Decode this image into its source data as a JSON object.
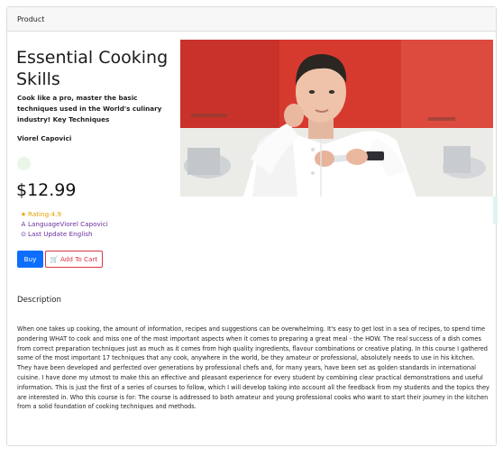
{
  "header": {
    "title": "Product"
  },
  "course": {
    "title": "Essential Cooking Skills",
    "subtitle": "Cook like a pro, master the basic techniques used in the World's culinary industry! Key Techniques",
    "author": "Viorel Capovici",
    "price": "$12.99",
    "rating_text": "Rating:4.9",
    "language_text": "LanguageViorel Capovici",
    "update_text": "Last Update English"
  },
  "actions": {
    "buy_label": "Buy",
    "cart_label": "Add To Cart"
  },
  "description": {
    "heading": "Description",
    "body": "When one takes up cooking, the amount of information, recipes and suggestions can be overwhelming. It's easy to get lost in a sea of recipes, to spend time pondering WHAT to cook and miss one of the most important aspects when it comes to preparing a great meal - the HOW. The real success of a dish comes from correct preparation techniques just as much as it comes from high quality ingredients, flavour combinations or creative plating. In this course I gathered some of the most important 17 techniques that any cook, anywhere in the world, be they amateur or professional, absolutely needs to use in his kitchen. They have been developed and perfected over generations by professional chefs and, for many years, have been set as golden standards in international cuisine. I have done my utmost to make this an effective and pleasant experience for every student by combining clear practical demonstrations and useful information. This is just the first of a series of courses to follow, which I will develop taking into account all the feedback from my students and the topics they are interested in. Who this course is for: The course is addressed to both amateur and young professional cooks who want to start their journey in the kitchen from a solid foundation of cooking techniques and methods."
  },
  "icons": {
    "rating": "star-icon",
    "language": "language-icon",
    "update": "info-circle-icon",
    "cart": "cart-icon"
  },
  "colors": {
    "primary": "#0d6efd",
    "danger": "#dc3545",
    "rating": "#e0a100",
    "meta": "#6a2ea0"
  }
}
